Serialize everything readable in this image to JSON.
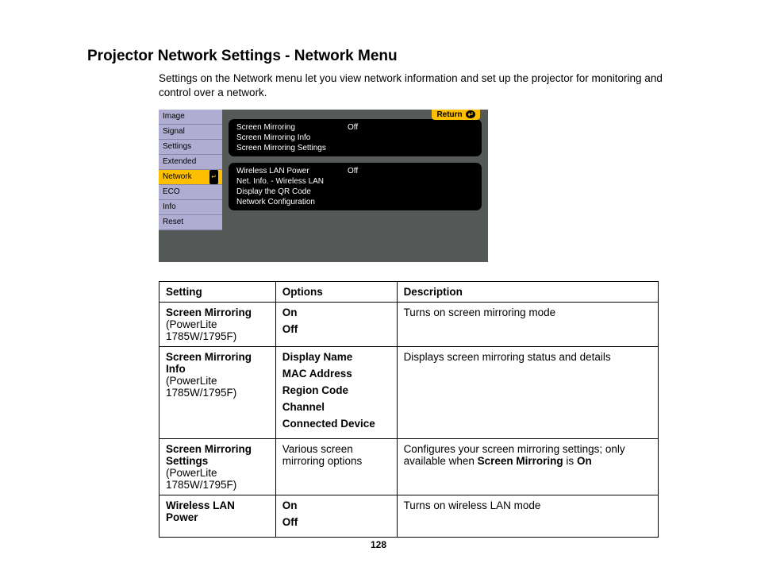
{
  "title": "Projector Network Settings - Network Menu",
  "intro": "Settings on the Network menu let you view network information and set up the projector for monitoring and control over a network.",
  "panel": {
    "sidebar": [
      "Image",
      "Signal",
      "Settings",
      "Extended",
      "Network",
      "ECO",
      "Info",
      "Reset"
    ],
    "selected": "Network",
    "returnLabel": "Return",
    "group1": [
      {
        "label": "Screen Mirroring",
        "value": "Off"
      },
      {
        "label": "Screen Mirroring Info",
        "value": ""
      },
      {
        "label": "Screen Mirroring Settings",
        "value": ""
      }
    ],
    "group2": [
      {
        "label": "Wireless LAN Power",
        "value": "Off"
      },
      {
        "label": "Net. Info. - Wireless LAN",
        "value": ""
      },
      {
        "label": "Display the QR Code",
        "value": ""
      },
      {
        "label": "Network Configuration",
        "value": ""
      }
    ]
  },
  "table": {
    "headers": [
      "Setting",
      "Options",
      "Description"
    ],
    "rows": [
      {
        "setting_bold": "Screen Mirroring",
        "setting_note": "(PowerLite 1785W/1795F)",
        "options": [
          "On",
          "Off"
        ],
        "options_bold": true,
        "desc": "Turns on screen mirroring mode"
      },
      {
        "setting_bold": "Screen Mirroring Info",
        "setting_note": "(PowerLite 1785W/1795F)",
        "options": [
          "Display Name",
          "MAC Address",
          "Region Code",
          "Channel",
          "Connected Device"
        ],
        "options_bold": true,
        "desc": "Displays screen mirroring status and details"
      },
      {
        "setting_bold": "Screen Mirroring Settings",
        "setting_note": "(PowerLite 1785W/1795F)",
        "options": [
          "Various screen mirroring options"
        ],
        "options_bold": false,
        "desc_pre": "Configures your screen mirroring settings; only available when ",
        "desc_bold": "Screen Mirroring",
        "desc_mid": " is ",
        "desc_bold2": "On"
      },
      {
        "setting_bold": "Wireless LAN Power",
        "setting_note": "",
        "options": [
          "On",
          "Off"
        ],
        "options_bold": true,
        "desc": "Turns on wireless LAN mode"
      }
    ]
  },
  "pageNumber": "128"
}
